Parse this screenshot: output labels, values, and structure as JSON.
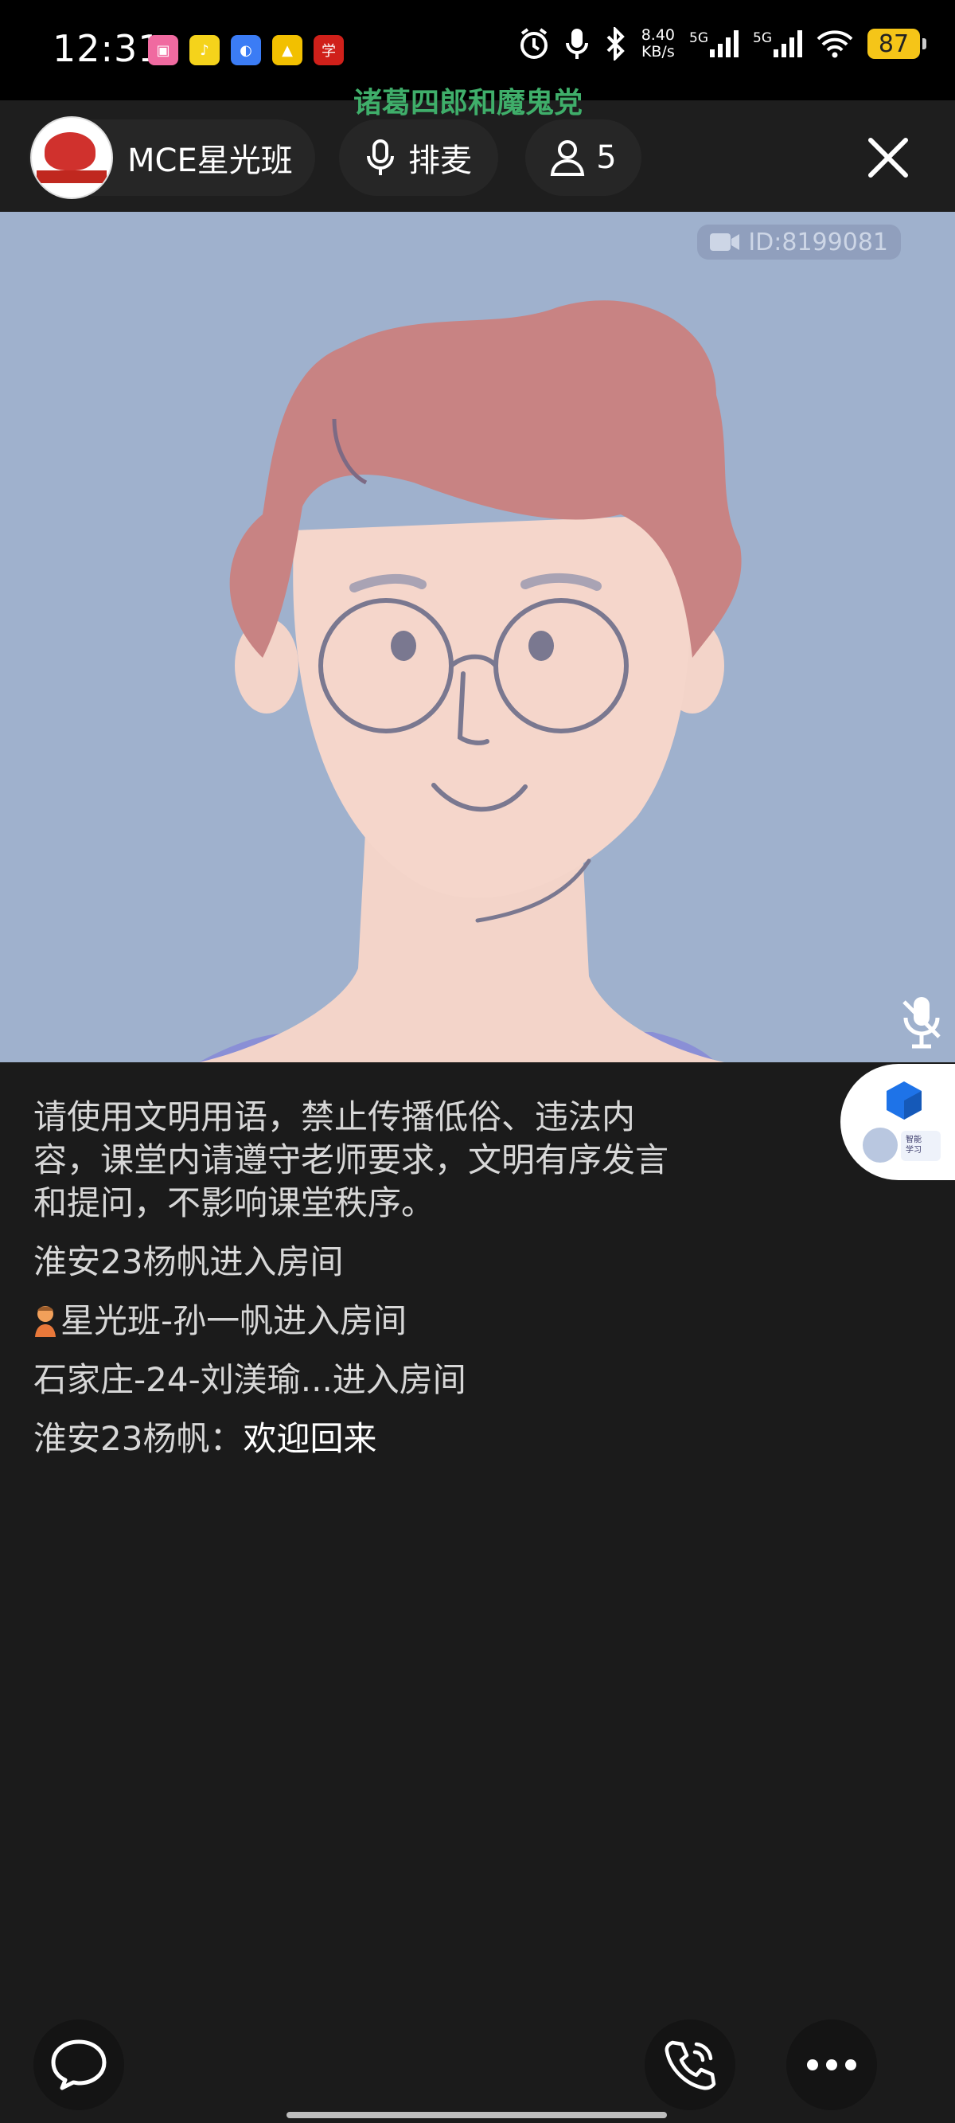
{
  "status_bar": {
    "time": "12:31",
    "net_speed_value": "8.40",
    "net_speed_unit": "KB/s",
    "signal1": "5G",
    "signal2": "5G",
    "battery": "87",
    "app_icons": [
      "bilibili",
      "qq-music",
      "app-blue",
      "yonghui",
      "xuexi"
    ]
  },
  "header": {
    "marquee": "诸葛四郎和魔鬼党",
    "room_name": "MCE星光班",
    "queue_label": "排麦",
    "audience_count": "5"
  },
  "video": {
    "id_label": "ID:8199081"
  },
  "chat": {
    "notice": "请使用文明用语，禁止传播低俗、违法内容，课堂内请遵守老师要求，文明有序发言和提问，不影响课堂秩序。",
    "messages": [
      {
        "text": "淮安23杨帆进入房间"
      },
      {
        "text": "星光班-孙一帆进入房间"
      },
      {
        "text": "石家庄-24-刘渼瑜...进入房间"
      },
      {
        "sender": "淮安23杨帆：",
        "text": "欢迎回来"
      }
    ]
  },
  "colors": {
    "accent_green": "#3fae6a",
    "video_bg": "#9fb1cd",
    "page_bg": "#1b1b1b"
  }
}
